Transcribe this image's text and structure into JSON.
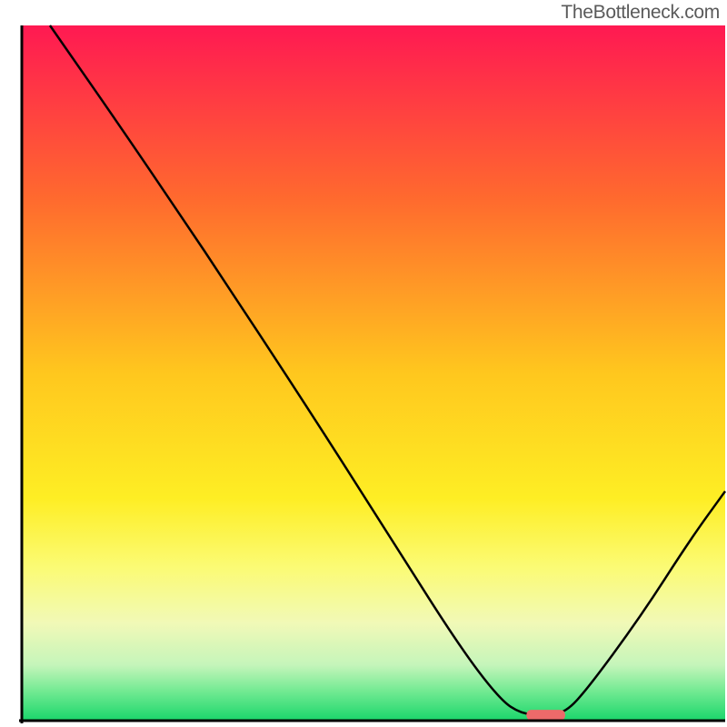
{
  "watermark": "TheBottleneck.com",
  "chart_data": {
    "type": "line",
    "title": "",
    "xlabel": "",
    "ylabel": "",
    "xlim": [
      0,
      100
    ],
    "ylim": [
      0,
      100
    ],
    "gradient_stops": [
      {
        "offset": 0,
        "color": "#ff1952"
      },
      {
        "offset": 25,
        "color": "#ff6a2e"
      },
      {
        "offset": 50,
        "color": "#ffc71e"
      },
      {
        "offset": 68,
        "color": "#feee24"
      },
      {
        "offset": 78,
        "color": "#fbfb75"
      },
      {
        "offset": 86,
        "color": "#f1f9b7"
      },
      {
        "offset": 92,
        "color": "#c5f5ba"
      },
      {
        "offset": 96,
        "color": "#6de990"
      },
      {
        "offset": 100,
        "color": "#1ad66b"
      }
    ],
    "curve_points": [
      {
        "x": 4.0,
        "y": 100.0
      },
      {
        "x": 15.0,
        "y": 84.0
      },
      {
        "x": 25.0,
        "y": 69.0
      },
      {
        "x": 27.0,
        "y": 66.0
      },
      {
        "x": 40.0,
        "y": 46.0
      },
      {
        "x": 52.0,
        "y": 27.0
      },
      {
        "x": 62.0,
        "y": 11.0
      },
      {
        "x": 68.0,
        "y": 3.0
      },
      {
        "x": 71.0,
        "y": 1.0
      },
      {
        "x": 74.0,
        "y": 0.8
      },
      {
        "x": 77.0,
        "y": 1.0
      },
      {
        "x": 80.0,
        "y": 4.0
      },
      {
        "x": 88.0,
        "y": 15.0
      },
      {
        "x": 95.0,
        "y": 26.0
      },
      {
        "x": 100.0,
        "y": 33.0
      }
    ],
    "marker": {
      "x": 74.5,
      "y": 0.8,
      "width": 5.5,
      "height": 1.5,
      "color": "#ed6a6a"
    },
    "axes": {
      "left_x": 3.0,
      "right_x": 100.0,
      "bottom_y": 0.0,
      "top_y": 100.0,
      "stroke": "#000000",
      "stroke_width": 3
    }
  }
}
